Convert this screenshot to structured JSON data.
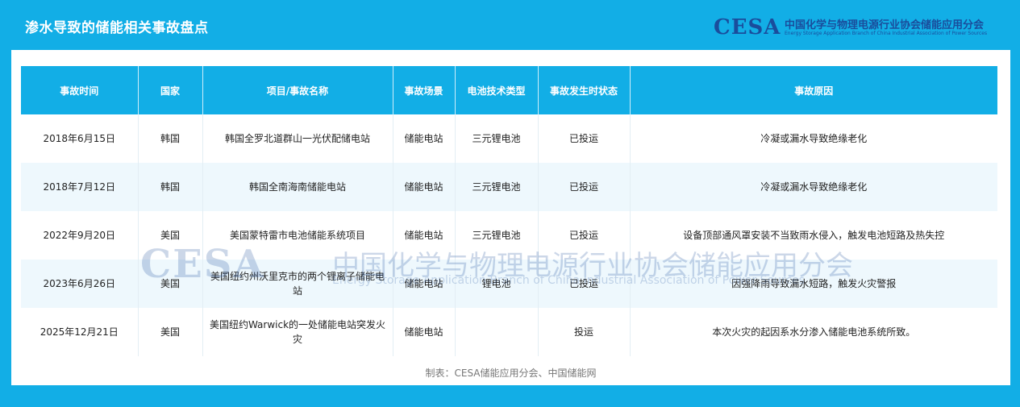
{
  "header": {
    "title": "渗水导致的储能相关事故盘点",
    "logo_mark": "CESA",
    "logo_cn": "中国化学与物理电源行业协会储能应用分会",
    "logo_en": "Energy Storage Application Branch of China Industrial Association of Power Sources"
  },
  "table": {
    "columns": [
      "事故时间",
      "国家",
      "项目/事故名称",
      "事故场景",
      "电池技术类型",
      "事故发生时状态",
      "事故原因"
    ],
    "rows": [
      [
        "2018年6月15日",
        "韩国",
        "韩国全罗北道群山一光伏配储电站",
        "储能电站",
        "三元锂电池",
        "已投运",
        "冷凝或漏水导致绝缘老化"
      ],
      [
        "2018年7月12日",
        "韩国",
        "韩国全南海南储能电站",
        "储能电站",
        "三元锂电池",
        "已投运",
        "冷凝或漏水导致绝缘老化"
      ],
      [
        "2022年9月20日",
        "美国",
        "美国蒙特雷市电池储能系统项目",
        "储能电站",
        "三元锂电池",
        "已投运",
        "设备顶部通风罩安装不当致雨水侵入，触发电池短路及热失控"
      ],
      [
        "2023年6月26日",
        "美国",
        "美国纽约州沃里克市的两个锂离子储能电站",
        "储能电站",
        "锂电池",
        "已投运",
        "因强降雨导致漏水短路，触发火灾警报"
      ],
      [
        "2025年12月21日",
        "美国",
        "美国纽约Warwick的一处储能电站突发火灾",
        "储能电站",
        "",
        "投运",
        "本次火灾的起因系水分渗入储能电池系统所致。"
      ]
    ]
  },
  "source": "制表：CESA储能应用分会、中国储能网",
  "colors": {
    "brand_blue": "#12aee6",
    "logo_navy": "#1a4d9c",
    "row_alt": "#eef8fd"
  }
}
